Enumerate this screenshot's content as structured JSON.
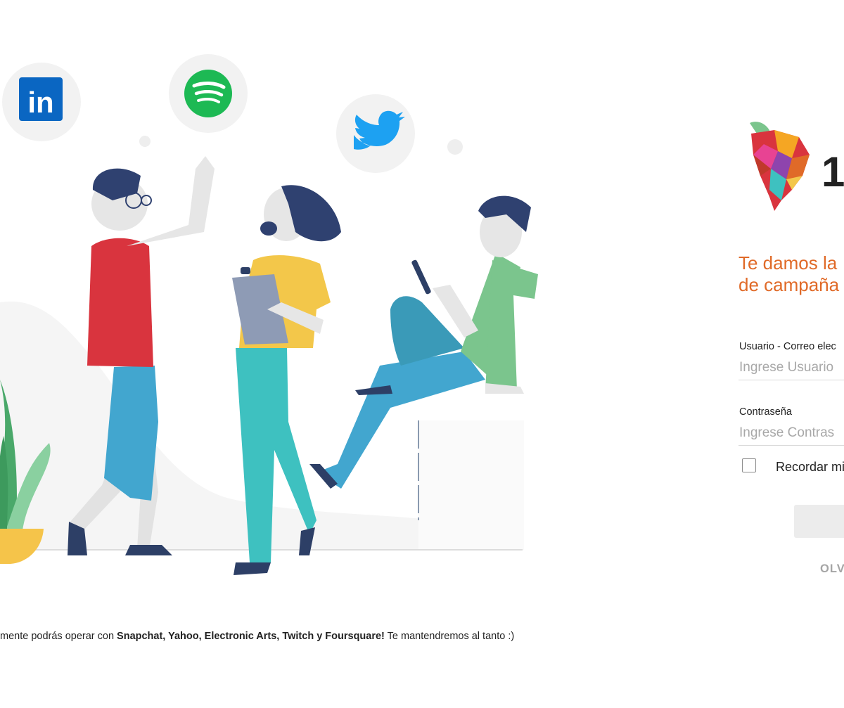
{
  "illustration": {
    "social_icons": [
      "linkedin-icon",
      "spotify-icon",
      "twitter-icon"
    ],
    "colors": {
      "linkedin": "#0a66c2",
      "spotify": "#1db954",
      "twitter": "#1da1f2",
      "bubble": "#f2f2f2"
    }
  },
  "footer": {
    "prefix": "mente podrás operar con ",
    "platforms": "Snapchat, Yahoo, Electronic Arts, Twitch y Foursquare!",
    "suffix": " Te mantendremos al tanto :)"
  },
  "login": {
    "brand_text": "1",
    "tagline_line1": "Te damos la",
    "tagline_line2": "de campaña",
    "username_label": "Usuario - Correo elec",
    "username_placeholder": "Ingrese Usuario",
    "password_label": "Contraseña",
    "password_placeholder": "Ingrese Contras",
    "remember_label": "Recordar mi",
    "login_button_label": "",
    "forgot_label": "OLV",
    "accent_color": "#e06a28"
  }
}
